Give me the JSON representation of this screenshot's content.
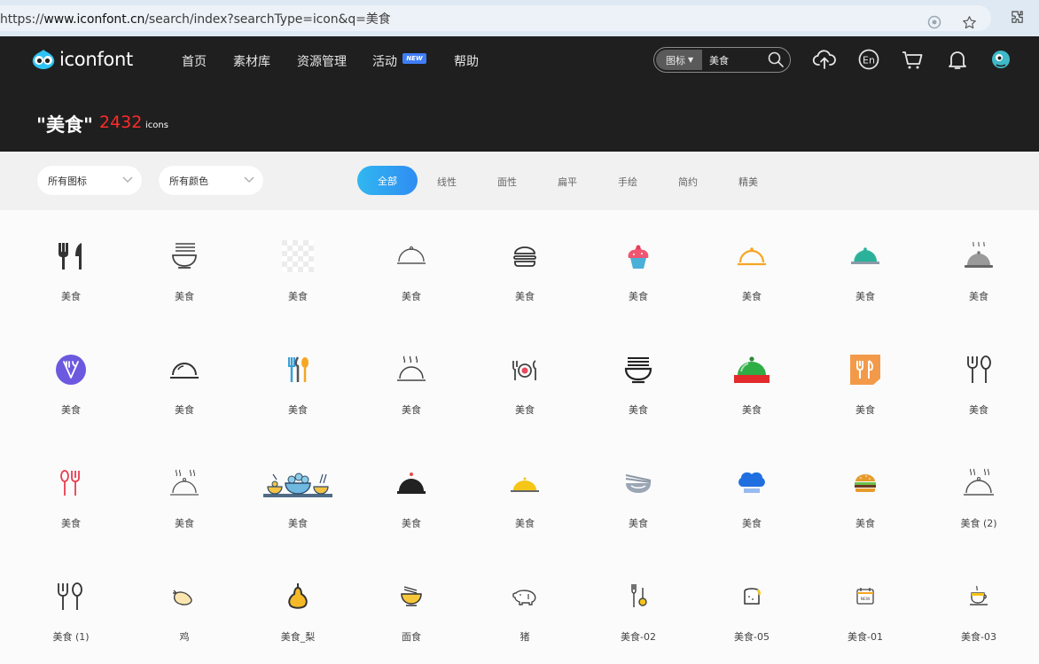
{
  "browser": {
    "url_prefix": "https://",
    "url_domain": "www.iconfont.cn",
    "url_path": "/search/index?searchType=icon&q=美食"
  },
  "header": {
    "logo_text": "iconfont",
    "nav": [
      "首页",
      "素材库",
      "资源管理",
      "活动",
      "帮助"
    ],
    "new_badge": "NEW",
    "search_type": "图标",
    "search_value": "美食",
    "accent_color": "#ff2a2a"
  },
  "results": {
    "query_display": "\"美食\"",
    "count": "2432",
    "unit": "icons"
  },
  "filters": {
    "dropdown_1": "所有图标",
    "dropdown_2": "所有颜色",
    "tabs": [
      "全部",
      "线性",
      "面性",
      "扁平",
      "手绘",
      "简约",
      "精美"
    ],
    "active_tab": "全部"
  },
  "icons": [
    {
      "label": "美食",
      "icon": "fork-knife-icon"
    },
    {
      "label": "美食",
      "icon": "noodle-bowl-icon"
    },
    {
      "label": "美食",
      "icon": "transparent-placeholder-icon"
    },
    {
      "label": "美食",
      "icon": "cloche-outline-icon"
    },
    {
      "label": "美食",
      "icon": "burger-outline-icon"
    },
    {
      "label": "美食",
      "icon": "cupcake-icon"
    },
    {
      "label": "美食",
      "icon": "cloche-orange-icon"
    },
    {
      "label": "美食",
      "icon": "cloche-teal-icon"
    },
    {
      "label": "美食",
      "icon": "cloche-steam-icon"
    },
    {
      "label": "美食",
      "icon": "purple-circle-utensils-icon"
    },
    {
      "label": "美食",
      "icon": "cloche-line-icon"
    },
    {
      "label": "美食",
      "icon": "colored-utensils-icon"
    },
    {
      "label": "美食",
      "icon": "cloche-steam-outline-icon"
    },
    {
      "label": "美食",
      "icon": "plate-utensils-icon"
    },
    {
      "label": "美食",
      "icon": "noodle-bowl-dark-icon"
    },
    {
      "label": "美食",
      "icon": "cloche-red-green-icon"
    },
    {
      "label": "美食",
      "icon": "orange-tile-utensils-icon"
    },
    {
      "label": "美食",
      "icon": "fork-spoon-outline-icon"
    },
    {
      "label": "美食",
      "icon": "red-fork-spoon-icon"
    },
    {
      "label": "美食",
      "icon": "cloche-steam-thin-icon"
    },
    {
      "label": "美食",
      "icon": "table-dishes-icon"
    },
    {
      "label": "美食",
      "icon": "cloche-black-icon"
    },
    {
      "label": "美食",
      "icon": "cloche-yellow-icon"
    },
    {
      "label": "美食",
      "icon": "bowl-chopsticks-icon"
    },
    {
      "label": "美食",
      "icon": "chef-hat-icon"
    },
    {
      "label": "美食",
      "icon": "burger-color-icon"
    },
    {
      "label": "美食 (2)",
      "icon": "cloche-steam-large-icon"
    },
    {
      "label": "美食 (1)",
      "icon": "fork-spoon-line-icon"
    },
    {
      "label": "鸡",
      "icon": "chicken-icon"
    },
    {
      "label": "美食_梨",
      "icon": "pear-icon"
    },
    {
      "label": "面食",
      "icon": "noodle-bowl-yellow-icon"
    },
    {
      "label": "猪",
      "icon": "pig-icon"
    },
    {
      "label": "美食-02",
      "icon": "fork-spoon-yellow-icon"
    },
    {
      "label": "美食-05",
      "icon": "toast-icon"
    },
    {
      "label": "美食-01",
      "icon": "new-calendar-icon"
    },
    {
      "label": "美食-03",
      "icon": "coffee-cup-icon"
    }
  ]
}
